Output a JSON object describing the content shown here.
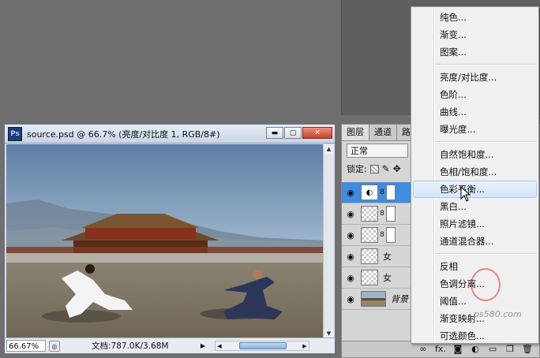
{
  "document": {
    "title": "source.psd @ 66.7% (亮度/对比度 1, RGB/8#)",
    "app_icon_label": "Ps",
    "minimize_symbol": "▬",
    "maximize_symbol": "▢",
    "close_symbol": "✕",
    "zoom": "66.67%",
    "doc_info": "文档:787.0K/3.68M"
  },
  "layers_panel": {
    "tabs": [
      "图层",
      "通道",
      "路"
    ],
    "blend_mode": "正常",
    "lock_label": "锁定:",
    "layers": [
      {
        "name": "",
        "type": "adjustment",
        "selected": true
      },
      {
        "name": "",
        "type": "masked"
      },
      {
        "name": "",
        "type": "masked"
      },
      {
        "name": "女",
        "type": "pixel"
      },
      {
        "name": "女",
        "type": "pixel"
      },
      {
        "name": "背景",
        "type": "background"
      }
    ],
    "bottom_fx": "fx."
  },
  "context_menu": {
    "items": [
      {
        "label": "纯色..."
      },
      {
        "label": "渐变..."
      },
      {
        "label": "图案..."
      },
      {
        "sep": true
      },
      {
        "label": "亮度/对比度..."
      },
      {
        "label": "色阶..."
      },
      {
        "label": "曲线..."
      },
      {
        "label": "曝光度..."
      },
      {
        "sep": true
      },
      {
        "label": "自然饱和度..."
      },
      {
        "label": "色相/饱和度..."
      },
      {
        "label": "色彩平衡...",
        "hover": true
      },
      {
        "label": "黑白..."
      },
      {
        "label": "照片滤镜..."
      },
      {
        "label": "通道混合器..."
      },
      {
        "sep": true
      },
      {
        "label": "反相"
      },
      {
        "label": "色调分离..."
      },
      {
        "label": "阈值..."
      },
      {
        "label": "渐变映射..."
      },
      {
        "label": "可选颜色..."
      }
    ]
  },
  "watermark": "ps580.com",
  "colors": {
    "selection": "#3f8ce0",
    "menu_hover": "#d4e6fb"
  }
}
